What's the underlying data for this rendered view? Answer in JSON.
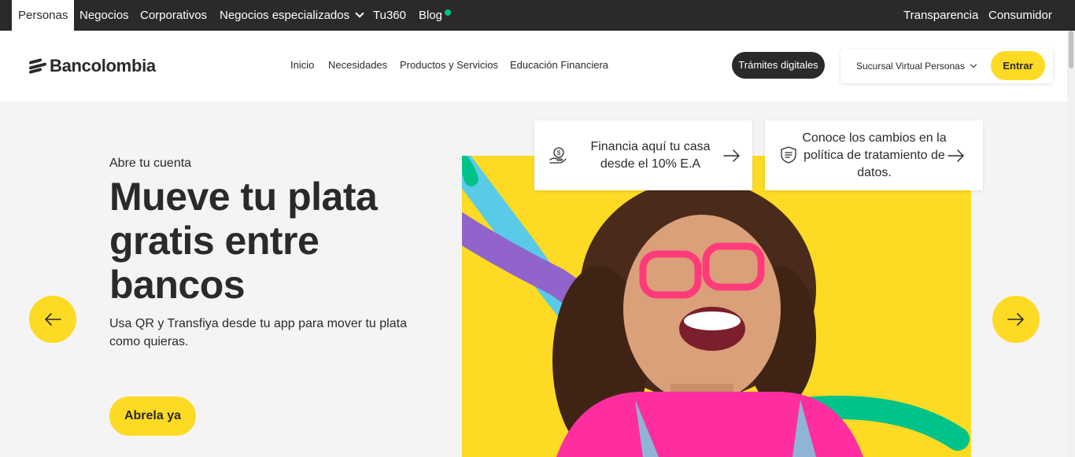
{
  "topbar": {
    "tabs": [
      {
        "label": "Personas",
        "active": true
      },
      {
        "label": "Negocios"
      },
      {
        "label": "Corporativos"
      },
      {
        "label": "Negocios especializados"
      },
      {
        "label": "Tu360"
      },
      {
        "label": "Blog"
      }
    ],
    "right_links": [
      "Transparencia",
      "Consumidor"
    ]
  },
  "header": {
    "logo_text": "Bancolombia",
    "nav": [
      "Inicio",
      "Necesidades",
      "Productos y Servicios",
      "Educación Financiera"
    ],
    "tramites_label": "Trámites digitales",
    "sucursal_select": "Sucursal Virtual Personas",
    "entrar_label": "Entrar"
  },
  "cards": [
    {
      "text_line1": "Financia aquí tu casa",
      "text_line2": "desde el 10% E.A",
      "icon": "house-money-icon"
    },
    {
      "text_line1": "Conoce los cambios en la",
      "text_line2": "política de tratamiento de",
      "text_line3": "datos.",
      "icon": "shield-document-icon"
    }
  ],
  "hero": {
    "eyebrow": "Abre tu cuenta",
    "headline": "Mueve tu plata gratis entre bancos",
    "description": "Usa QR y Transfiya desde tu app para mover tu plata como quieras.",
    "cta_label": "Abrela ya"
  },
  "colors": {
    "brand_yellow": "#fdda24",
    "dark": "#2c2a29",
    "accent_green": "#00c389",
    "purple": "#9164cc",
    "light_blue": "#59cbe8",
    "pink": "#ff2ea0"
  }
}
